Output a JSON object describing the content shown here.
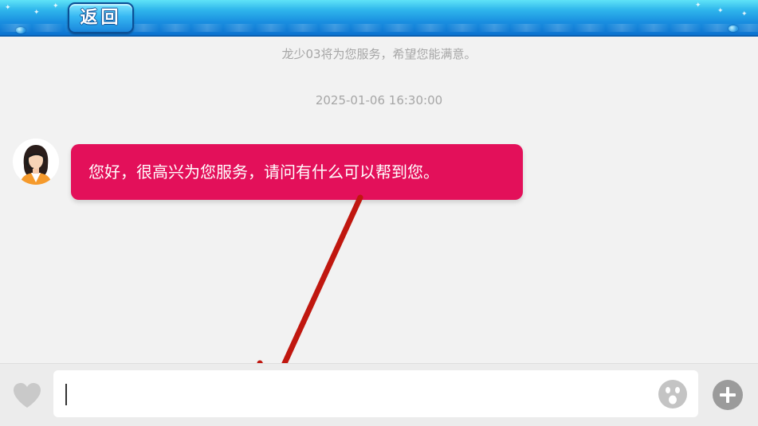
{
  "header": {
    "back_label": "返回"
  },
  "chat": {
    "service_notice": "龙少03将为您服务，希望您能满意。",
    "timestamp": "2025-01-06 16:30:00",
    "messages": [
      {
        "sender": "agent",
        "avatar_icon": "customer-service-agent-icon",
        "text": "您好，很高兴为您服务，请问有什么可以帮到您。"
      }
    ]
  },
  "input_bar": {
    "input_value": "",
    "left_icon": "heart-icon",
    "emoji_icon": "emoji-icon",
    "plus_icon": "plus-icon"
  },
  "annotation": {
    "type": "arrow",
    "color": "#c0170f"
  },
  "colors": {
    "header_blue": "#1a8fe0",
    "bubble": "#e3105a",
    "background": "#f2f2f2",
    "muted_text": "#a6a6a6"
  }
}
